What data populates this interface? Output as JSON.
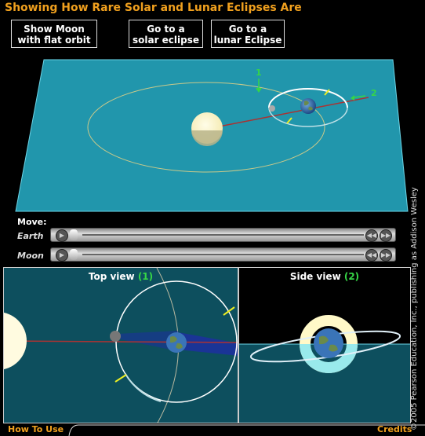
{
  "title": "Showing How Rare Solar and Lunar Eclipses Are",
  "buttons": {
    "flat_orbit": [
      "Show  Moon",
      "with flat orbit"
    ],
    "solar": [
      "Go to a",
      "solar eclipse"
    ],
    "lunar": [
      "Go to a",
      "lunar Eclipse"
    ]
  },
  "scene_markers": {
    "marker1": "1",
    "marker2": "2"
  },
  "move": {
    "label": "Move:",
    "earth": "Earth",
    "moon": "Moon"
  },
  "icons": {
    "play": "play-icon",
    "rewind": "rewind-icon",
    "forward": "fast-forward-icon"
  },
  "top_view": {
    "title": "Top view",
    "num": "(1)"
  },
  "side_view": {
    "title": "Side view",
    "num": "(2)"
  },
  "copyright": "©2005 Pearson Education, Inc., publishing as Addison Wesley",
  "footer": {
    "how_to_use": "How To Use",
    "credits": "Credits"
  },
  "colors": {
    "accent": "#f0a01e",
    "plane": "#1f8fa6",
    "marker": "#36d646"
  }
}
